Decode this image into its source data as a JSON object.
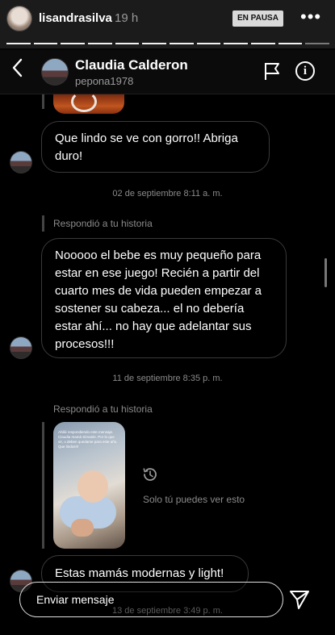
{
  "story": {
    "username": "lisandrasilva",
    "time": "19 h",
    "pause_label": "EN PAUSA",
    "more_icon": "more-horizontal-icon",
    "segments_total": 12,
    "segments_done": 11
  },
  "dm": {
    "back_icon": "chevron-left-icon",
    "name": "Claudia Calderon",
    "handle": "pepona1978",
    "flag_icon": "flag-icon",
    "info_icon": "info-icon"
  },
  "thread": {
    "msg1": "Que lindo se ve con gorro!! Abriga duro!",
    "ts1": "02 de septiembre 8:11 a. m.",
    "replied1": "Respondió a tu historia",
    "msg2": "Nooooo el bebe es muy pequeño para estar en ese juego! Recién a partir del cuarto mes de vida pueden empezar a sostener su cabeza... el no debería estar ahí... no hay que adelantar sus procesos!!!",
    "ts2": "11 de septiembre 8:35 p. m.",
    "replied2": "Respondió a tu historia",
    "thumb_text": "Ahiliii respondiendo este mensaje. Claudia mamá Sírvanle. Por lo que sé, o deben quedarse para este año. Que lindos!!!",
    "expired_note": "Solo tú puedes ver esto",
    "msg3": "Estas mamás modernas y light!",
    "ts3": "13 de septiembre 3:49 p. m."
  },
  "composer": {
    "placeholder": "Enviar mensaje",
    "send_icon": "send-icon"
  }
}
